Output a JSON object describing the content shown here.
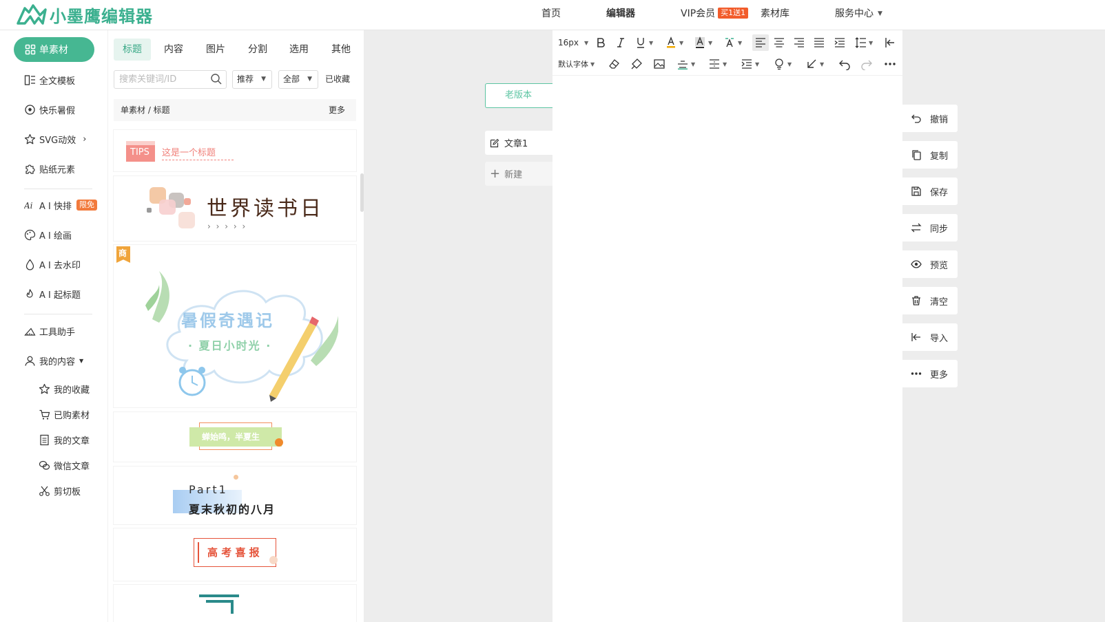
{
  "header": {
    "logo_text": "小墨鹰编辑器",
    "nav": [
      {
        "label": "首页"
      },
      {
        "label": "编辑器"
      },
      {
        "label": "VIP会员",
        "badge": "买1送1"
      },
      {
        "label": "素材库"
      },
      {
        "label": "服务中心"
      }
    ]
  },
  "sidebar": {
    "active": "单素材",
    "items": [
      {
        "label": "全文模板"
      },
      {
        "label": "快乐暑假"
      },
      {
        "label": "SVG动效"
      },
      {
        "label": "贴纸元素"
      },
      {
        "label": "A I 快排",
        "badge": "限免"
      },
      {
        "label": "A I 绘画"
      },
      {
        "label": "A I 去水印"
      },
      {
        "label": "A I 起标题"
      },
      {
        "label": "工具助手"
      },
      {
        "label": "我的内容"
      }
    ],
    "sub_items": [
      {
        "label": "我的收藏"
      },
      {
        "label": "已购素材"
      },
      {
        "label": "我的文章"
      },
      {
        "label": "微信文章"
      },
      {
        "label": "剪切板"
      }
    ]
  },
  "panel": {
    "tabs": [
      "标题",
      "内容",
      "图片",
      "分割",
      "选用",
      "其他"
    ],
    "active_tab": "标题",
    "search_placeholder": "搜索关键词/ID",
    "filter_sort": "推荐",
    "filter_scope": "全部",
    "favorites_label": "已收藏",
    "breadcrumb": "单素材 / 标题",
    "more_label": "更多",
    "cards": {
      "tips_tag": "TIPS",
      "tips_title": "这是一个标题",
      "reading_title": "世界读书日",
      "reading_arrows": "› › › › ›",
      "commercial_tag": "商",
      "summer_title": "暑假奇遇记",
      "summer_subtitle": "· 夏日小时光 ·",
      "green_banner": "蝉始鸣，半夏生",
      "part_label": "Part1",
      "part_title": "夏末秋初的八月",
      "exam_title": "高 考 喜 报"
    }
  },
  "docs": {
    "old_version": "老版本",
    "article": "文章1",
    "new_label": "新建"
  },
  "editor": {
    "font_size": "16px",
    "font_family": "默认字体"
  },
  "actions": [
    {
      "label": "撤销",
      "icon": "undo-icon"
    },
    {
      "label": "复制",
      "icon": "copy-icon"
    },
    {
      "label": "保存",
      "icon": "save-icon"
    },
    {
      "label": "同步",
      "icon": "sync-icon"
    },
    {
      "label": "预览",
      "icon": "eye-icon"
    },
    {
      "label": "清空",
      "icon": "trash-icon"
    },
    {
      "label": "导入",
      "icon": "import-icon"
    },
    {
      "label": "更多",
      "icon": "more-icon"
    }
  ],
  "colors": {
    "brand": "#46b792",
    "accent_orange": "#f25c2b"
  }
}
